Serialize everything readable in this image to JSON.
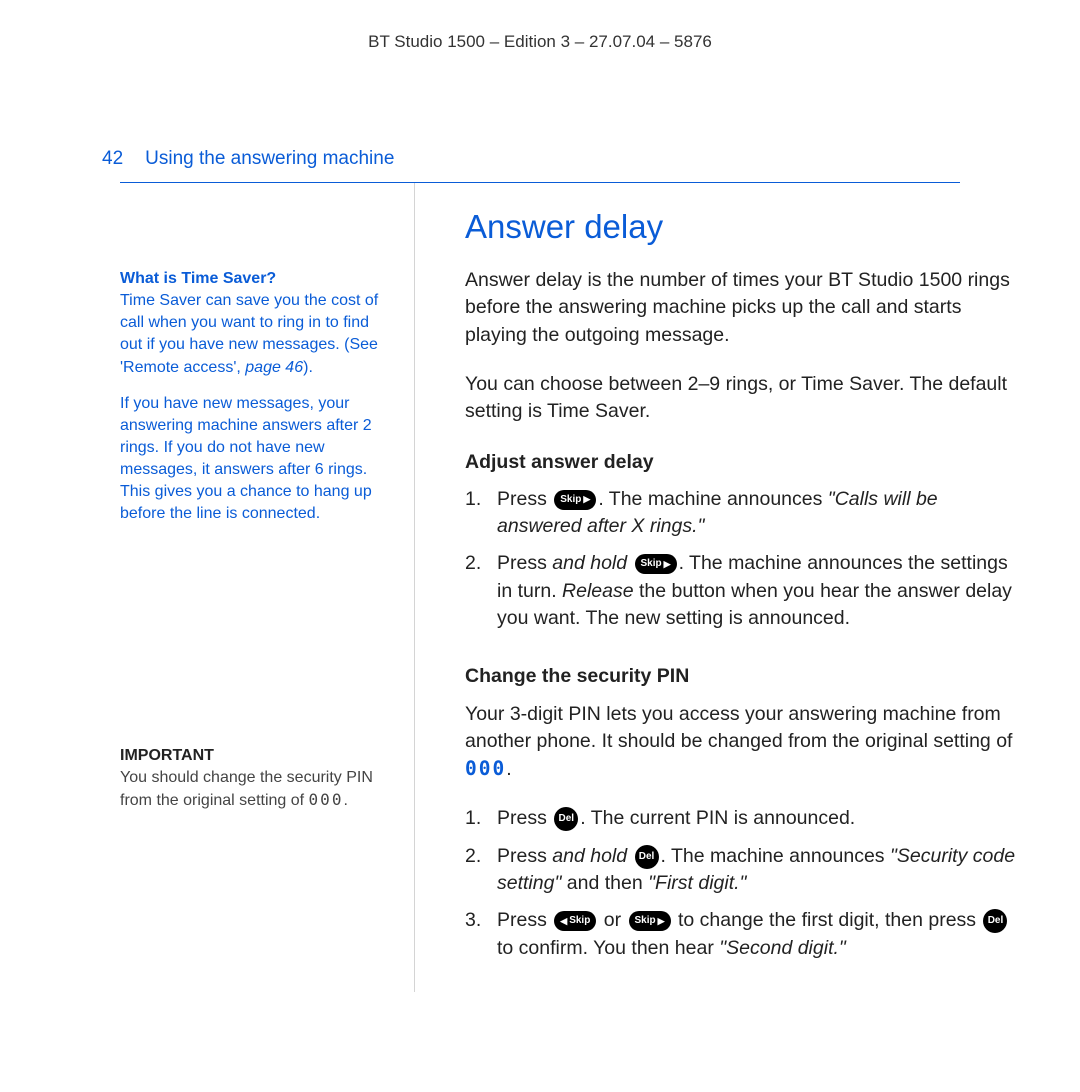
{
  "doc": {
    "meta": "BT Studio 1500 – Edition 3 – 27.07.04 – 5876",
    "page_number": "42",
    "section": "Using the answering machine"
  },
  "side": {
    "ts_heading": "What is Time Saver?",
    "ts_p1_a": "Time Saver can save you the cost of call when you want to ring in to find out if you have new messages. (See 'Remote access', ",
    "ts_p1_ref": "page 46",
    "ts_p1_b": ").",
    "ts_p2": "If you have new messages, your answering machine answers after 2 rings. If you do not have new messages, it answers after 6 rings. This gives you a chance to hang up before the line is connected.",
    "imp_heading": "IMPORTANT",
    "imp_p_a": "You should change the security PIN from the original setting of ",
    "imp_code": "000",
    "imp_p_b": "."
  },
  "main": {
    "title": "Answer delay",
    "intro1": "Answer delay is the number of times your BT Studio 1500 rings before the answering machine picks up the call and starts playing the outgoing message.",
    "intro2": "You can choose between 2–9 rings, or Time Saver. The default setting is Time Saver.",
    "adjust_heading": "Adjust answer delay",
    "step_a1_a": "Press ",
    "step_a1_b": ". The machine announces ",
    "step_a1_q": "\"Calls will be answered after X rings.\"",
    "step_a2_a": "Press ",
    "step_a2_hold": "and hold",
    "step_a2_b": " ",
    "step_a2_c": ". The machine announces the settings in turn. ",
    "step_a2_rel": "Release",
    "step_a2_d": " the button when you hear the answer delay you want. The new setting is announced.",
    "pin_heading": "Change the security PIN",
    "pin_intro_a": "Your 3-digit PIN lets you access your answering machine from another phone. It should be changed from the original setting of ",
    "pin_intro_code": "000",
    "pin_intro_b": ".",
    "pin1_a": "Press ",
    "pin1_b": ". The current PIN is announced.",
    "pin2_a": "Press ",
    "pin2_hold": "and hold",
    "pin2_b": " ",
    "pin2_c": ". The machine announces ",
    "pin2_q1": "\"Security code setting\"",
    "pin2_and": " and then ",
    "pin2_q2": "\"First digit.\"",
    "pin3_a": "Press ",
    "pin3_or": " or ",
    "pin3_b": " to change the first digit, then press ",
    "pin3_c": " to confirm. You then hear ",
    "pin3_q": "\"Second digit.\"",
    "btn_skip_fwd": "Skip",
    "btn_skip_back": "Skip",
    "btn_del": "Del"
  }
}
